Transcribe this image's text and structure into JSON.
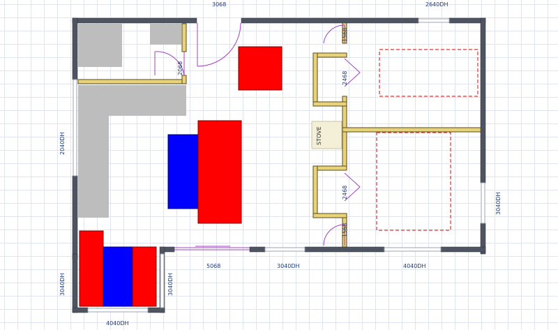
{
  "plan": {
    "labels": {
      "top_door": "3068",
      "top_right_window": "2640DH",
      "left_window": "2040DH",
      "inner_door_left": "2068",
      "closet_door_upper": "1568",
      "closet_door_upper_left": "2468",
      "stove": "STOVE",
      "closet_door_lower_left": "2468",
      "closet_door_lower": "1568",
      "right_window": "3040DH",
      "bottom_slider": "5068",
      "bottom_window_mid": "3040DH",
      "bottom_window_right": "4040DH",
      "bay_left_window": "3040DH",
      "bay_right_window": "3040DH",
      "bay_bottom_window": "4040DH"
    }
  },
  "colors": {
    "wall": "#4e5561",
    "interior_wall_fill": "#e8d27a",
    "interior_wall_stroke": "#5a4b1c",
    "counter": "#bdbdbd",
    "furniture_red": "#ff0000",
    "furniture_blue": "#0000ff",
    "door_swing": "#a040c0",
    "bed_outline": "#e03030",
    "window": "#9aa3b5",
    "stove": "#f4f0d8"
  }
}
